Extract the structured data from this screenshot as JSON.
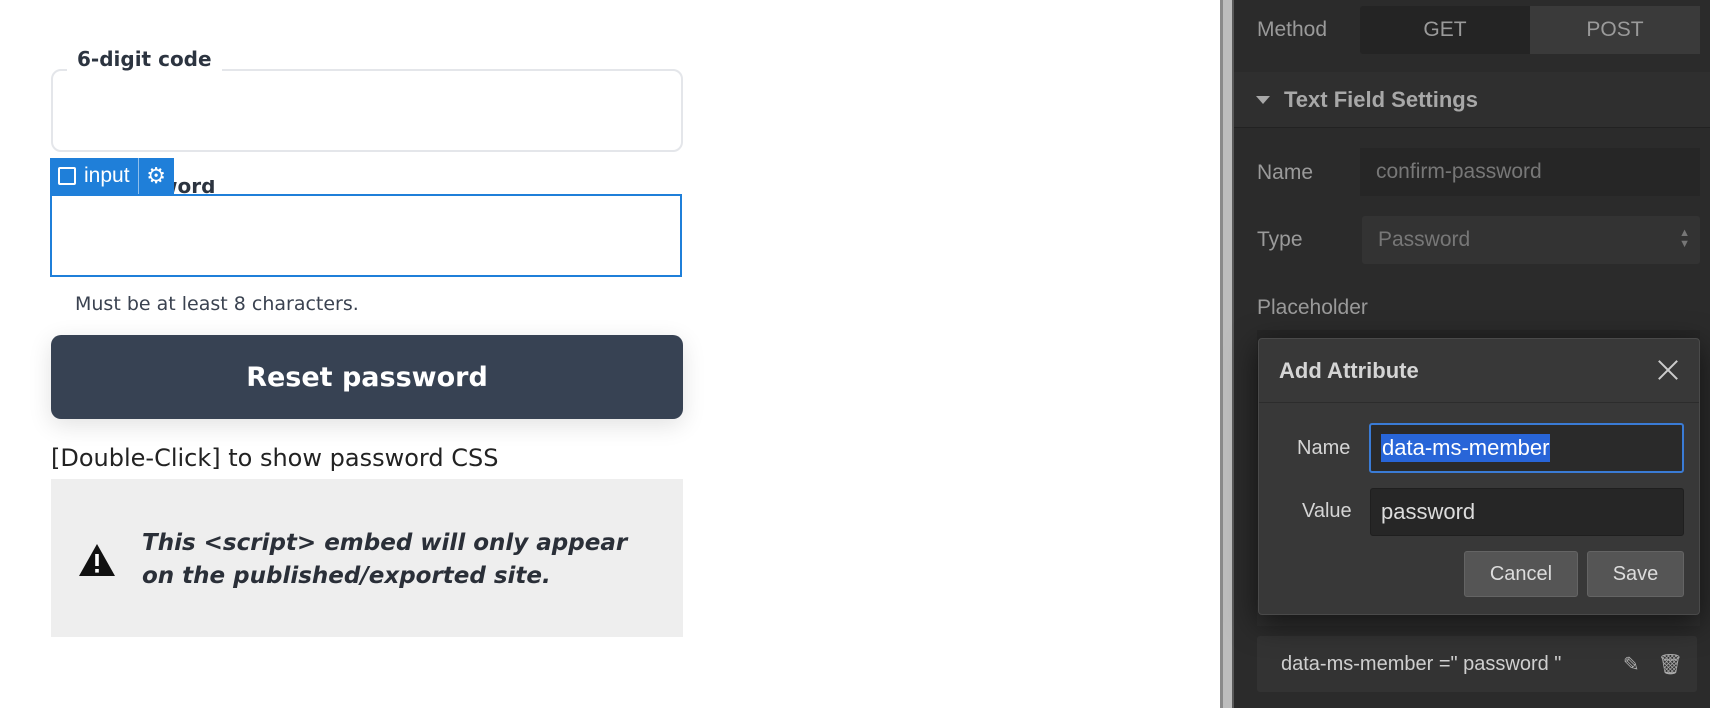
{
  "canvas": {
    "code_label": "6-digit code",
    "element_tag": "input",
    "password_label_visible": "word",
    "hint": "Must be at least 8 characters.",
    "reset_button": "Reset password",
    "dblclick_note": "[Double-Click] to show password CSS",
    "embed_notice": "This <script> embed will only appear on the published/exported site."
  },
  "panel": {
    "method_label": "Method",
    "method_options": [
      "GET",
      "POST"
    ],
    "section_title": "Text Field Settings",
    "name_label": "Name",
    "name_value": "confirm-password",
    "type_label": "Type",
    "type_value": "Password",
    "placeholder_label": "Placeholder",
    "attribute_row": "data-ms-member =\" password \""
  },
  "modal": {
    "title": "Add Attribute",
    "name_label": "Name",
    "name_value": "data-ms-member",
    "value_label": "Value",
    "value_value": "password",
    "cancel": "Cancel",
    "save": "Save"
  },
  "colors": {
    "selection_blue": "#1f7fd9",
    "button_dark": "#374253",
    "panel_bg": "#2b2b2b"
  }
}
